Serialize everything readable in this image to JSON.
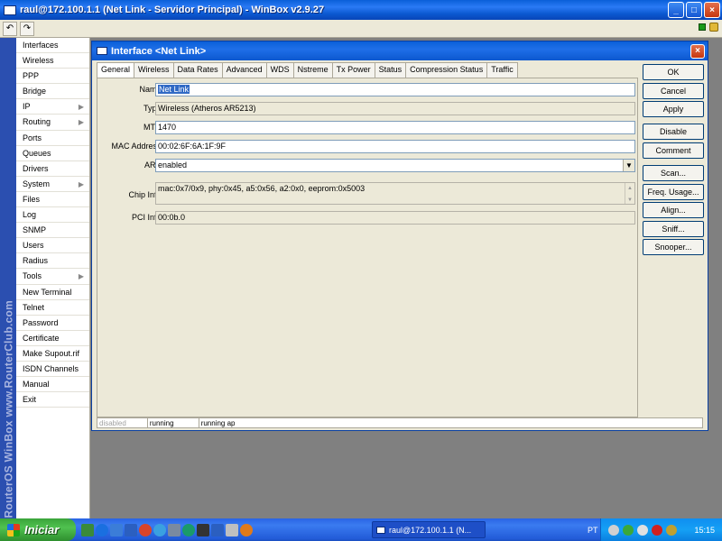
{
  "window": {
    "title": "raul@172.100.1.1 (Net Link - Servidor Principal) - WinBox v2.9.27",
    "controls": {
      "minimize": "_",
      "maximize": "□",
      "close": "×"
    }
  },
  "toolbar": {
    "undo": "↶",
    "redo": "↷"
  },
  "brand": "RouterOS WinBox    www.RouterClub.com",
  "menu": [
    {
      "label": "Interfaces",
      "arrow": ""
    },
    {
      "label": "Wireless",
      "arrow": ""
    },
    {
      "label": "PPP",
      "arrow": ""
    },
    {
      "label": "Bridge",
      "arrow": ""
    },
    {
      "label": "IP",
      "arrow": "▶"
    },
    {
      "label": "Routing",
      "arrow": "▶"
    },
    {
      "label": "Ports",
      "arrow": ""
    },
    {
      "label": "Queues",
      "arrow": ""
    },
    {
      "label": "Drivers",
      "arrow": ""
    },
    {
      "label": "System",
      "arrow": "▶"
    },
    {
      "label": "Files",
      "arrow": ""
    },
    {
      "label": "Log",
      "arrow": ""
    },
    {
      "label": "SNMP",
      "arrow": ""
    },
    {
      "label": "Users",
      "arrow": ""
    },
    {
      "label": "Radius",
      "arrow": ""
    },
    {
      "label": "Tools",
      "arrow": "▶"
    },
    {
      "label": "New Terminal",
      "arrow": ""
    },
    {
      "label": "Telnet",
      "arrow": ""
    },
    {
      "label": "Password",
      "arrow": ""
    },
    {
      "label": "Certificate",
      "arrow": ""
    },
    {
      "label": "Make Supout.rif",
      "arrow": ""
    },
    {
      "label": "ISDN Channels",
      "arrow": ""
    },
    {
      "label": "Manual",
      "arrow": ""
    },
    {
      "label": "Exit",
      "arrow": ""
    }
  ],
  "dialog": {
    "title": "Interface <Net Link>",
    "close": "×",
    "tabs": [
      "General",
      "Wireless",
      "Data Rates",
      "Advanced",
      "WDS",
      "Nstreme",
      "Tx Power",
      "Status",
      "Compression Status",
      "Traffic"
    ],
    "active_tab": "General",
    "fields": {
      "name": {
        "label": "Name:",
        "value": "Net Link"
      },
      "type": {
        "label": "Type:",
        "value": "Wireless (Atheros AR5213)"
      },
      "mtu": {
        "label": "MTU:",
        "value": "1470"
      },
      "mac": {
        "label": "MAC Address:",
        "value": "00:02:6F:6A:1F:9F"
      },
      "arp": {
        "label": "ARP:",
        "value": "enabled",
        "dropdown": "▼"
      },
      "chip": {
        "label": "Chip Info:",
        "value": "mac:0x7/0x9, phy:0x45, a5:0x56, a2:0x0, eeprom:0x5003",
        "scroll_up": "▲",
        "scroll_down": "▼"
      },
      "pci": {
        "label": "PCI Info:",
        "value": "00:0b.0"
      }
    },
    "buttons": [
      "OK",
      "Cancel",
      "Apply",
      "Disable",
      "Comment",
      "Scan...",
      "Freq. Usage...",
      "Align...",
      "Sniff...",
      "Snooper..."
    ],
    "status": [
      "disabled",
      "running",
      "running ap"
    ]
  },
  "taskbar": {
    "start": "Iniciar",
    "task": "raul@172.100.1.1 (N...",
    "lang": "PT",
    "clock": "15:15"
  },
  "colors": {
    "title_blue": "#0a5fd8",
    "dialog_bg": "#ece9d8",
    "brand_strip": "#2b4fb0",
    "taskbar": "#2a64e4"
  }
}
